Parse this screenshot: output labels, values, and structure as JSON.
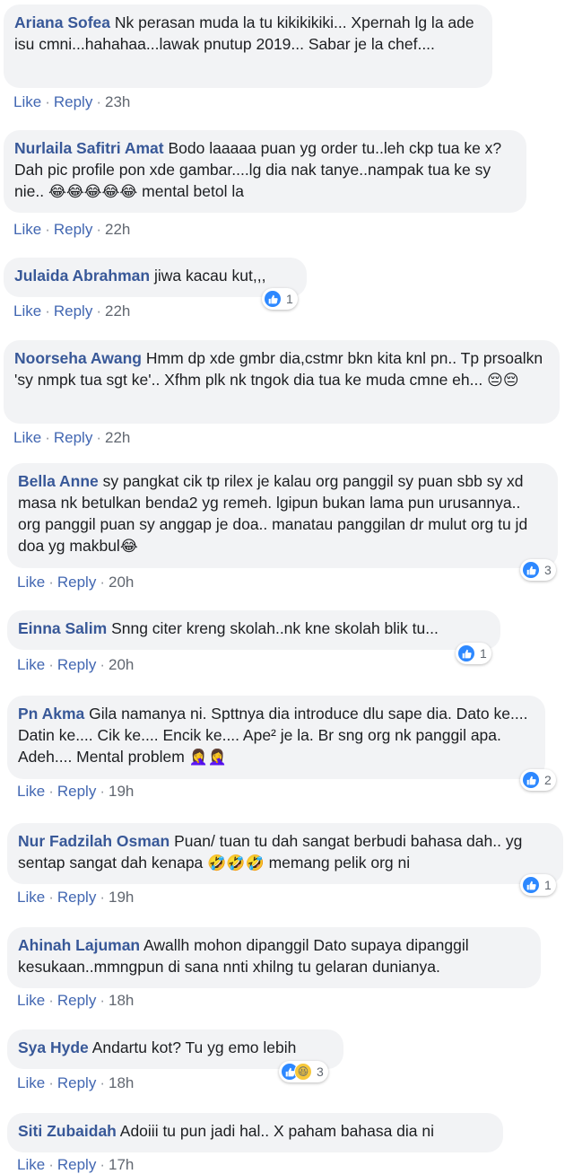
{
  "actions": {
    "like": "Like",
    "reply": "Reply",
    "separator": "·"
  },
  "colors": {
    "author": "#385898",
    "link": "#4267b2",
    "bubble": "#f2f3f5",
    "like_blue": "#2d88ff"
  },
  "comments": [
    {
      "author": "Ariana Sofea",
      "text": "Nk perasan muda la tu kikikikiki... Xpernah lg la ade isu cmni...hahahaa...lawak pnutup 2019... Sabar je la chef....",
      "time": "23h"
    },
    {
      "author": "Nurlaila Safitri Amat",
      "text": "Bodo laaaaa puan yg order tu..leh ckp tua ke x? Dah pic profile pon xde gambar....lg dia nak tanye..nampak tua ke sy nie..",
      "emoji": "😂😂😂😂😂",
      "text_after": "mental betol la",
      "time": "22h"
    },
    {
      "author": "Julaida Abrahman",
      "text": "jiwa kacau kut,,,",
      "time": "22h",
      "reactions": {
        "types": [
          "like-icon"
        ],
        "count": "1"
      }
    },
    {
      "author": "Noorseha Awang",
      "text": "Hmm dp xde gmbr dia,cstmr bkn kita knl pn.. Tp prsoalkn 'sy nmpk tua sgt ke'.. Xfhm plk nk tngok dia tua ke muda cmne eh...",
      "emoji": "😔😔",
      "time": "22h"
    },
    {
      "author": "Bella Anne",
      "text": "sy pangkat cik tp rilex je kalau org panggil sy puan sbb sy xd masa nk betulkan benda2 yg remeh. lgipun bukan lama pun urusannya.. org panggil puan sy anggap je doa.. manatau panggilan dr mulut org tu jd doa yg makbul",
      "emoji": "😂",
      "time": "20h",
      "reactions": {
        "types": [
          "like-icon"
        ],
        "count": "3"
      }
    },
    {
      "author": "Einna Salim",
      "text": "Snng citer kreng skolah..nk kne skolah blik tu...",
      "time": "20h",
      "reactions": {
        "types": [
          "like-icon"
        ],
        "count": "1"
      }
    },
    {
      "author": "Pn Akma",
      "text": "Gila namanya ni. Spttnya dia introduce dlu sape dia. Dato ke.... Datin ke.... Cik ke.... Encik ke.... Ape² je la. Br sng org nk panggil apa. Adeh.... Mental problem",
      "emoji": "🤦‍♀️🤦‍♀️",
      "time": "19h",
      "reactions": {
        "types": [
          "like-icon"
        ],
        "count": "2"
      }
    },
    {
      "author": "Nur Fadzilah Osman",
      "text": "Puan/ tuan tu dah sangat berbudi bahasa dah.. yg sentap sangat dah kenapa",
      "emoji": "🤣🤣🤣",
      "text_after": "memang pelik org ni",
      "time": "19h",
      "reactions": {
        "types": [
          "like-icon"
        ],
        "count": "1"
      }
    },
    {
      "author": "Ahinah Lajuman",
      "text": "Awallh mohon dipanggil Dato supaya dipanggil kesukaan..mmngpun di sana nnti xhilng tu gelaran dunianya.",
      "time": "18h"
    },
    {
      "author": "Sya Hyde",
      "text": "Andartu kot? Tu yg emo lebih",
      "time": "18h",
      "reactions": {
        "types": [
          "like-icon",
          "haha-icon"
        ],
        "count": "3"
      }
    },
    {
      "author": "Siti Zubaidah",
      "text": "Adoiii tu pun jadi hal.. X paham bahasa dia ni",
      "time": "17h"
    }
  ]
}
